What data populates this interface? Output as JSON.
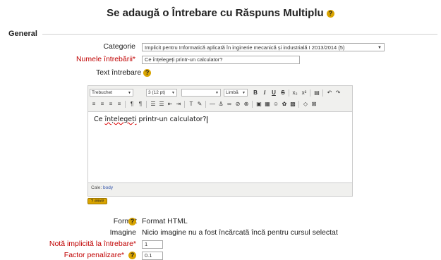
{
  "page": {
    "title": "Se adaugă o Întrebare cu Răspuns Multiplu",
    "help_icon": "question-help-icon",
    "help_glyph": "?"
  },
  "section": {
    "legend": "General"
  },
  "form": {
    "category": {
      "label": "Categorie",
      "selected": "Implicit pentru Informatică aplicată în inginerie mecanică și industrială I 2013/2014 (5)",
      "arrow": "▼"
    },
    "question_name": {
      "label": "Numele întrebării*",
      "value": "Ce înțelegeți printr-un calculator?"
    },
    "question_text": {
      "label": "Text întrebare"
    },
    "editor": {
      "font_family": "Trebuchet",
      "font_size": "3 (12 pt)",
      "paragraph": "",
      "language": "Limbă",
      "arrow": "▼",
      "buttons_row1": [
        "B",
        "I",
        "U",
        "S",
        "x₂",
        "x²",
        "▤",
        "↶",
        "↷"
      ],
      "buttons_row2": [
        "≡",
        "≡",
        "≡",
        "≡",
        "¶",
        "¶",
        "☰",
        "☰",
        "⇤",
        "⇥",
        "T",
        "✎",
        "—",
        "⚓",
        "∞",
        "⊘",
        "⊗",
        "▣",
        "▦",
        "☺",
        "✿",
        "▩",
        "◇",
        "⊠"
      ],
      "content_pre": "Ce ",
      "content_spell": "înțelegeți",
      "content_post": " printr-un calculator?",
      "path_label": "Cale:",
      "path_value": "body",
      "resize_label": "? ####"
    },
    "format": {
      "label": "Format",
      "value": "Format HTML"
    },
    "image": {
      "label": "Imagine",
      "value": "Nicio imagine nu a fost încărcată încă pentru cursul selectat"
    },
    "default_grade": {
      "label": "Notă implicită la întrebare*",
      "value": "1"
    },
    "penalty": {
      "label": "Factor penalizare*",
      "value": "0.1"
    }
  },
  "colors": {
    "required": "#c00000",
    "help": "#d9a400",
    "link": "#3355aa"
  }
}
